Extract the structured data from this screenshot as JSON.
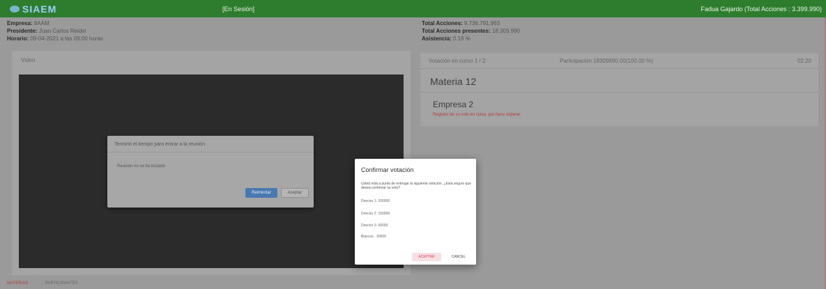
{
  "topbar": {
    "logo": "SIAEM",
    "session_status": "[En Sesión]",
    "user": "Fadua Gajardo (Total Acciones : 3.399.990)"
  },
  "meeting": {
    "empresa_label": "Empresa:",
    "empresa_value": "8AAM",
    "presidente_label": "Presidente:",
    "presidente_value": "Juan Carlos Reidel",
    "horario_label": "Horario:",
    "horario_value": "09-04-2021 a las 09:00 horas",
    "total_acciones_label": "Total Acciones:",
    "total_acciones_value": "9.736.791.963",
    "presentes_label": "Total Acciones presentes:",
    "presentes_value": "18.309.990",
    "asistencia_label": "Asistencia:",
    "asistencia_value": "0.19 %"
  },
  "video": {
    "title": "Video",
    "dialog": {
      "header": "Terminó el tiempo para entrar a la reunión.",
      "body": "Reunión no se ha iniciado",
      "primary": "Reintentar",
      "secondary": "Aceptar"
    }
  },
  "vote": {
    "current": "Votación en curso 1 / 2",
    "participation": "Participación 18309990.00(100.00 %)",
    "timer": "02:20",
    "materia": "Materia 12",
    "empresa": "Empresa 2",
    "register": "Registro de su voto en curso, por favor esperar."
  },
  "confirm": {
    "title": "Confirmar votación",
    "message": "Usted está a punto de entregar la siguiente votación. ¿Está seguro que desea confirmar su voto?",
    "lines": [
      "Director 1: 200000",
      "Director 2: 150000",
      "Director 3: 50000",
      "Blancos : 20000"
    ],
    "accept": "ACEPTAR",
    "cancel": "CANCEL"
  },
  "tabs": [
    "MATERIAS",
    "PARTICIPANTES"
  ]
}
